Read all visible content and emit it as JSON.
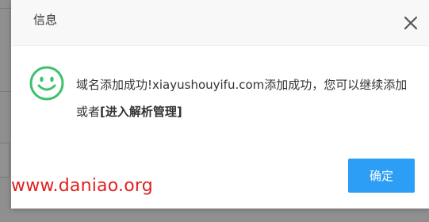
{
  "dialog": {
    "title": "信息",
    "message_prefix": "域名添加成功!xiayushouyifu.com添加成功，您可以继续添加或者",
    "message_link": "[进入解析管理]",
    "confirm_label": "确定",
    "icons": {
      "status": "smile-icon",
      "close": "close-icon"
    }
  },
  "colors": {
    "accent": "#2d9ef5",
    "success": "#3cc26a",
    "watermark": "#e02020"
  },
  "watermark": {
    "text": "www.daniao.org"
  }
}
